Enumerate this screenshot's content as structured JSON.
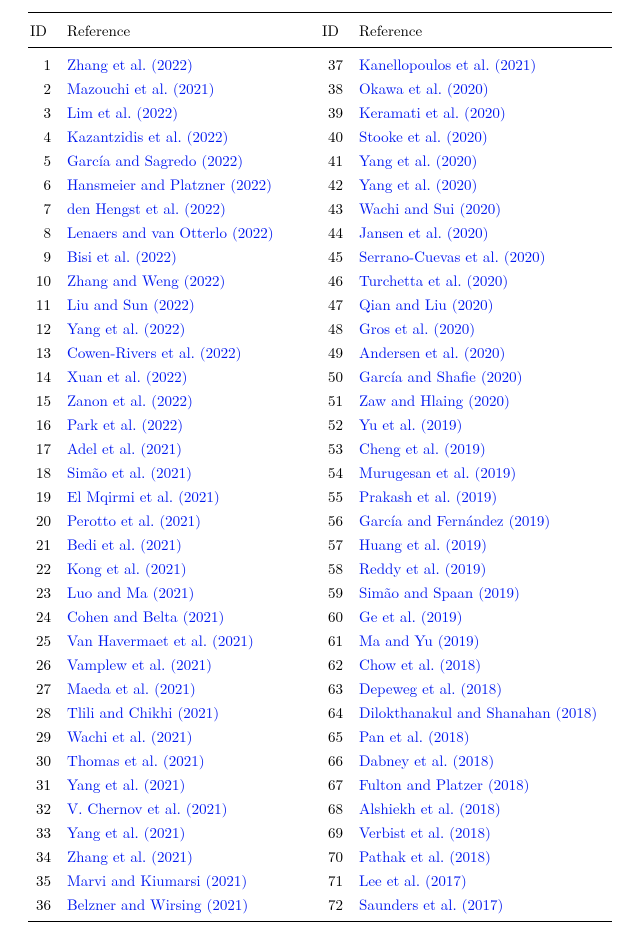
{
  "headers": {
    "id": "ID",
    "ref": "Reference"
  },
  "link_color": "#0018ef",
  "rows": [
    {
      "id": 1,
      "ref": "Zhang et al. (2022)"
    },
    {
      "id": 2,
      "ref": "Mazouchi et al. (2021)"
    },
    {
      "id": 3,
      "ref": "Lim et al. (2022)"
    },
    {
      "id": 4,
      "ref": "Kazantzidis et al. (2022)"
    },
    {
      "id": 5,
      "ref": "García and Sagredo (2022)"
    },
    {
      "id": 6,
      "ref": "Hansmeier and Platzner (2022)"
    },
    {
      "id": 7,
      "ref": "den Hengst et al. (2022)"
    },
    {
      "id": 8,
      "ref": "Lenaers and van Otterlo (2022)"
    },
    {
      "id": 9,
      "ref": "Bisi et al. (2022)"
    },
    {
      "id": 10,
      "ref": "Zhang and Weng (2022)"
    },
    {
      "id": 11,
      "ref": "Liu and Sun (2022)"
    },
    {
      "id": 12,
      "ref": "Yang et al. (2022)"
    },
    {
      "id": 13,
      "ref": "Cowen-Rivers et al. (2022)"
    },
    {
      "id": 14,
      "ref": "Xuan et al. (2022)"
    },
    {
      "id": 15,
      "ref": "Zanon et al. (2022)"
    },
    {
      "id": 16,
      "ref": "Park et al. (2022)"
    },
    {
      "id": 17,
      "ref": "Adel et al. (2021)"
    },
    {
      "id": 18,
      "ref": "Simão et al. (2021)"
    },
    {
      "id": 19,
      "ref": "El Mqirmi et al. (2021)"
    },
    {
      "id": 20,
      "ref": "Perotto et al. (2021)"
    },
    {
      "id": 21,
      "ref": "Bedi et al. (2021)"
    },
    {
      "id": 22,
      "ref": "Kong et al. (2021)"
    },
    {
      "id": 23,
      "ref": "Luo and Ma (2021)"
    },
    {
      "id": 24,
      "ref": "Cohen and Belta (2021)"
    },
    {
      "id": 25,
      "ref": "Van Havermaet et al. (2021)"
    },
    {
      "id": 26,
      "ref": "Vamplew et al. (2021)"
    },
    {
      "id": 27,
      "ref": "Maeda et al. (2021)"
    },
    {
      "id": 28,
      "ref": "Tlili and Chikhi (2021)"
    },
    {
      "id": 29,
      "ref": "Wachi et al. (2021)"
    },
    {
      "id": 30,
      "ref": "Thomas et al. (2021)"
    },
    {
      "id": 31,
      "ref": "Yang et al. (2021)"
    },
    {
      "id": 32,
      "ref": "V. Chernov et al. (2021)"
    },
    {
      "id": 33,
      "ref": "Yang et al. (2021)"
    },
    {
      "id": 34,
      "ref": "Zhang et al. (2021)"
    },
    {
      "id": 35,
      "ref": "Marvi and Kiumarsi (2021)"
    },
    {
      "id": 36,
      "ref": "Belzner and Wirsing (2021)"
    },
    {
      "id": 37,
      "ref": "Kanellopoulos et al. (2021)"
    },
    {
      "id": 38,
      "ref": "Okawa et al. (2020)"
    },
    {
      "id": 39,
      "ref": "Keramati et al. (2020)"
    },
    {
      "id": 40,
      "ref": "Stooke et al. (2020)"
    },
    {
      "id": 41,
      "ref": "Yang et al. (2020)"
    },
    {
      "id": 42,
      "ref": "Yang et al. (2020)"
    },
    {
      "id": 43,
      "ref": "Wachi and Sui (2020)"
    },
    {
      "id": 44,
      "ref": "Jansen et al. (2020)"
    },
    {
      "id": 45,
      "ref": "Serrano-Cuevas et al. (2020)"
    },
    {
      "id": 46,
      "ref": "Turchetta et al. (2020)"
    },
    {
      "id": 47,
      "ref": "Qian and Liu (2020)"
    },
    {
      "id": 48,
      "ref": "Gros et al. (2020)"
    },
    {
      "id": 49,
      "ref": "Andersen et al. (2020)"
    },
    {
      "id": 50,
      "ref": "García and Shafie (2020)"
    },
    {
      "id": 51,
      "ref": "Zaw and Hlaing (2020)"
    },
    {
      "id": 52,
      "ref": "Yu et al. (2019)"
    },
    {
      "id": 53,
      "ref": "Cheng et al. (2019)"
    },
    {
      "id": 54,
      "ref": "Murugesan et al. (2019)"
    },
    {
      "id": 55,
      "ref": "Prakash et al. (2019)"
    },
    {
      "id": 56,
      "ref": "García and Fernández (2019)"
    },
    {
      "id": 57,
      "ref": "Huang et al. (2019)"
    },
    {
      "id": 58,
      "ref": "Reddy et al. (2019)"
    },
    {
      "id": 59,
      "ref": "Simão and Spaan (2019)"
    },
    {
      "id": 60,
      "ref": "Ge et al. (2019)"
    },
    {
      "id": 61,
      "ref": "Ma and Yu (2019)"
    },
    {
      "id": 62,
      "ref": "Chow et al. (2018)"
    },
    {
      "id": 63,
      "ref": "Depeweg et al. (2018)"
    },
    {
      "id": 64,
      "ref": "Dilokthanakul and Shanahan (2018)"
    },
    {
      "id": 65,
      "ref": "Pan et al. (2018)"
    },
    {
      "id": 66,
      "ref": "Dabney et al. (2018)"
    },
    {
      "id": 67,
      "ref": "Fulton and Platzer (2018)"
    },
    {
      "id": 68,
      "ref": "Alshiekh et al. (2018)"
    },
    {
      "id": 69,
      "ref": "Verbist et al. (2018)"
    },
    {
      "id": 70,
      "ref": "Pathak et al. (2018)"
    },
    {
      "id": 71,
      "ref": "Lee et al. (2017)"
    },
    {
      "id": 72,
      "ref": "Saunders et al. (2017)"
    }
  ]
}
